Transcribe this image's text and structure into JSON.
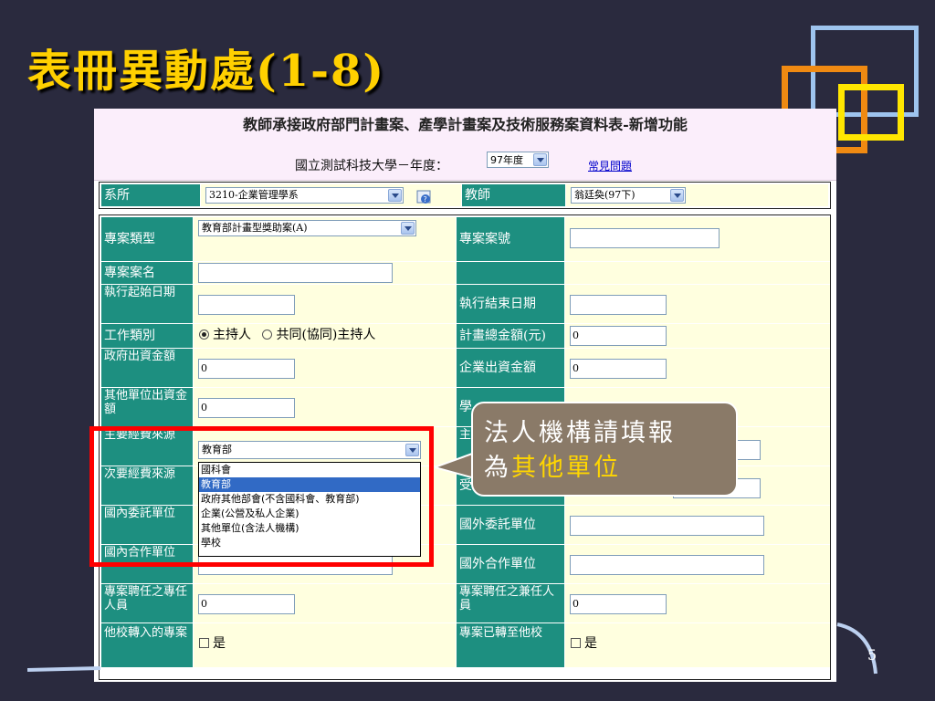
{
  "slide": {
    "title": "表冊異動處(1-8)",
    "page_number": "5"
  },
  "colors": {
    "title": "#ffd000",
    "label_bg": "#1d8f80",
    "value_bg": "#ffffdf",
    "highlight": "#ff0000",
    "callout_bg": "#8a7a68"
  },
  "header": {
    "title": "教師承接政府部門計畫案、產學計畫案及技術服務案資料表-新增功能",
    "subtitle": "國立測試科技大學－年度：",
    "year": "97年度",
    "faq_link": "常見問題"
  },
  "top": {
    "dept_label": "系所",
    "dept_value": "3210-企業管理學系",
    "teacher_label": "教師",
    "teacher_value": "翁廷奐(97下)"
  },
  "form": {
    "type_label": "專案類型",
    "type_value": "教育部計畫型獎助案(A)",
    "case_no_label": "專案案號",
    "name_label": "專案案名",
    "start_label": "執行起始日期",
    "end_label": "執行結束日期",
    "work_label": "工作類別",
    "work_opt1": "主持人",
    "work_opt2": "共同(協同)主持人",
    "total_label": "計畫總金額(元)",
    "total_value": "0",
    "gov_label": "政府出資金額",
    "gov_value": "0",
    "ent_label": "企業出資金額",
    "ent_value": "0",
    "other_label": "其他單位出資金額",
    "other_value": "0",
    "right_r7": "學",
    "main_fund_label": "主要經費來源",
    "main_fund_value": "教育部",
    "right_r8": "主",
    "sub_fund_label": "次要經費來源",
    "right_r9": "受",
    "dom_client_label": "國內委託單位",
    "for_client_label": "國外委託單位",
    "dom_coop_label": "國內合作單位",
    "for_coop_label": "國外合作單位",
    "staff_label": "專案聘任之專任人員",
    "staff_value": "0",
    "part_label": "專案聘任之兼任人員",
    "part_value": "0",
    "transfer_in_label": "他校轉入的專案",
    "transfer_in_chk": "是",
    "transfer_out_label": "專案已轉至他校",
    "transfer_out_chk": "是"
  },
  "dropdown_options": [
    "國科會",
    "教育部",
    "政府其他部會(不含國科會、教育部)",
    "企業(公營及私人企業)",
    "其他單位(含法人機構)",
    "學校"
  ],
  "callout": {
    "line1": "法人機構請填報",
    "line2_prefix": "為",
    "line2_highlight": "其他單位"
  }
}
